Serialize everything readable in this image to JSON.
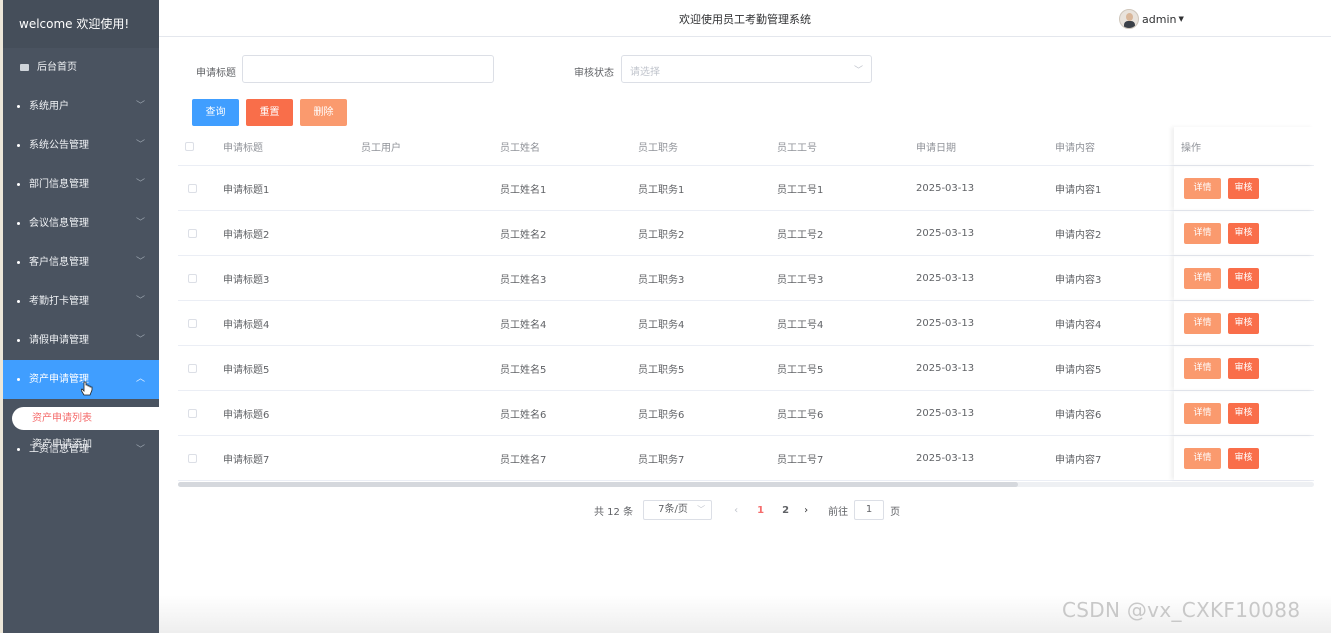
{
  "sidebar": {
    "brand": "welcome 欢迎使用!",
    "home": "后台首页",
    "items": [
      {
        "label": "系统用户"
      },
      {
        "label": "系统公告管理"
      },
      {
        "label": "部门信息管理"
      },
      {
        "label": "会议信息管理"
      },
      {
        "label": "客户信息管理"
      },
      {
        "label": "考勤打卡管理"
      },
      {
        "label": "请假申请管理"
      },
      {
        "label": "资产申请管理"
      },
      {
        "label": "工资信息管理"
      }
    ],
    "submenu": {
      "active": "资产申请列表",
      "next": "资产申请添加"
    }
  },
  "header": {
    "title": "欢迎使用员工考勤管理系统",
    "user": "admin"
  },
  "search": {
    "title_label": "申请标题",
    "title_value": "",
    "status_label": "审核状态",
    "status_placeholder": "请选择",
    "query": "查询",
    "reset": "重置",
    "delete": "删除"
  },
  "table": {
    "columns": [
      "申请标题",
      "员工用户",
      "员工姓名",
      "员工职务",
      "员工工号",
      "申请日期",
      "申请内容",
      "操作"
    ],
    "rows": [
      {
        "title": "申请标题1",
        "user": "",
        "name": "员工姓名1",
        "job": "员工职务1",
        "no": "员工工号1",
        "date": "2025-03-13",
        "content": "申请内容1"
      },
      {
        "title": "申请标题2",
        "user": "",
        "name": "员工姓名2",
        "job": "员工职务2",
        "no": "员工工号2",
        "date": "2025-03-13",
        "content": "申请内容2"
      },
      {
        "title": "申请标题3",
        "user": "",
        "name": "员工姓名3",
        "job": "员工职务3",
        "no": "员工工号3",
        "date": "2025-03-13",
        "content": "申请内容3"
      },
      {
        "title": "申请标题4",
        "user": "",
        "name": "员工姓名4",
        "job": "员工职务4",
        "no": "员工工号4",
        "date": "2025-03-13",
        "content": "申请内容4"
      },
      {
        "title": "申请标题5",
        "user": "",
        "name": "员工姓名5",
        "job": "员工职务5",
        "no": "员工工号5",
        "date": "2025-03-13",
        "content": "申请内容5"
      },
      {
        "title": "申请标题6",
        "user": "",
        "name": "员工姓名6",
        "job": "员工职务6",
        "no": "员工工号6",
        "date": "2025-03-13",
        "content": "申请内容6"
      },
      {
        "title": "申请标题7",
        "user": "",
        "name": "员工姓名7",
        "job": "员工职务7",
        "no": "员工工号7",
        "date": "2025-03-13",
        "content": "申请内容7"
      }
    ],
    "detail": "详情",
    "audit": "审核"
  },
  "pagination": {
    "total": "共 12 条",
    "page_size": "7条/页",
    "pages": [
      "1",
      "2"
    ],
    "goto": "前往",
    "goto_value": "1",
    "page_unit": "页"
  },
  "watermark": "CSDN @vx_CXKF10088",
  "colors": {
    "sidebar": "#4a5360",
    "active": "#409eff",
    "reset": "#f96e4a",
    "delete": "#fa9a6e",
    "danger_text": "#f56c6c"
  }
}
